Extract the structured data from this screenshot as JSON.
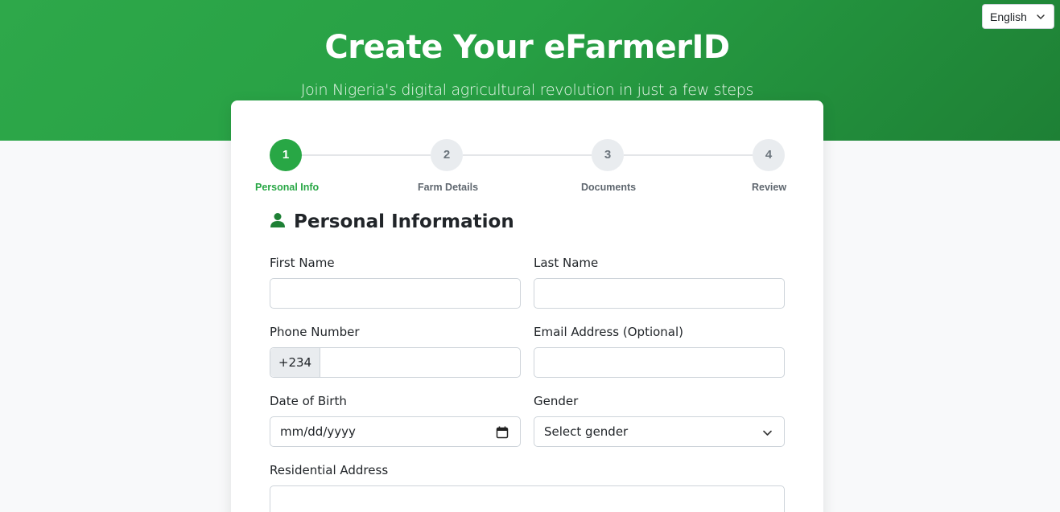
{
  "header": {
    "title": "Create Your eFarmerID",
    "subtitle": "Join Nigeria's digital agricultural revolution in just a few steps"
  },
  "language": {
    "selected": "English",
    "icon": "chevron-down-icon"
  },
  "steps": [
    {
      "number": "1",
      "label": "Personal Info",
      "active": true
    },
    {
      "number": "2",
      "label": "Farm Details",
      "active": false
    },
    {
      "number": "3",
      "label": "Documents",
      "active": false
    },
    {
      "number": "4",
      "label": "Review",
      "active": false
    }
  ],
  "section": {
    "title": "Personal Information",
    "icon": "person-icon"
  },
  "form": {
    "first_name": {
      "label": "First Name",
      "value": ""
    },
    "last_name": {
      "label": "Last Name",
      "value": ""
    },
    "phone": {
      "label": "Phone Number",
      "prefix": "+234",
      "value": ""
    },
    "email": {
      "label": "Email Address (Optional)",
      "value": ""
    },
    "dob": {
      "label": "Date of Birth",
      "placeholder": "mm/dd/yyyy"
    },
    "gender": {
      "label": "Gender",
      "selected": "Select gender"
    },
    "address": {
      "label": "Residential Address",
      "value": ""
    }
  },
  "colors": {
    "primary": "#28a745",
    "primary_dark": "#1e8035",
    "muted": "#e9ecef"
  }
}
